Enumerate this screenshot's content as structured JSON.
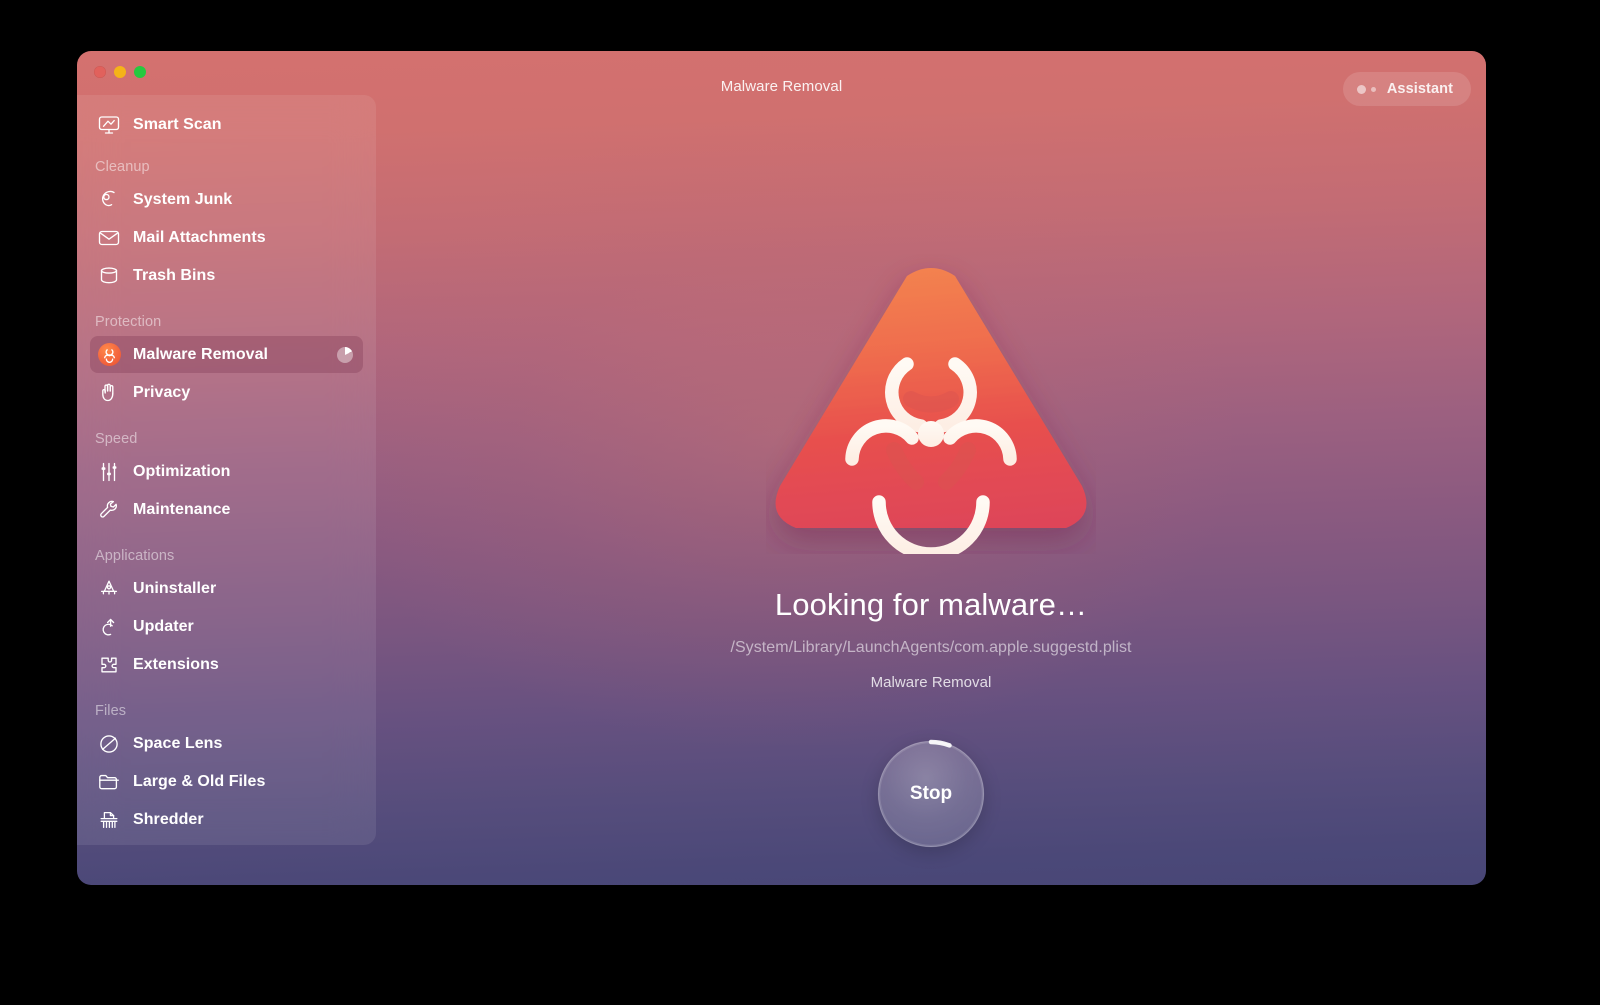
{
  "window": {
    "title": "Malware Removal",
    "traffic_lights": [
      {
        "name": "close",
        "color": "#e1615c"
      },
      {
        "name": "minimize",
        "color": "#f5b318"
      },
      {
        "name": "maximize",
        "color": "#26c93f"
      }
    ],
    "assistant_button": {
      "label": "Assistant"
    }
  },
  "sidebar": {
    "top_item": {
      "label": "Smart Scan",
      "icon": "monitor-scan-icon"
    },
    "sections": [
      {
        "title": "Cleanup",
        "items": [
          {
            "label": "System Junk",
            "icon": "broom-icon"
          },
          {
            "label": "Mail Attachments",
            "icon": "envelope-icon"
          },
          {
            "label": "Trash Bins",
            "icon": "trash-bin-icon"
          }
        ]
      },
      {
        "title": "Protection",
        "items": [
          {
            "label": "Malware Removal",
            "icon": "biohazard-icon",
            "selected": true,
            "progress_badge": true
          },
          {
            "label": "Privacy",
            "icon": "hand-palm-icon"
          }
        ]
      },
      {
        "title": "Speed",
        "items": [
          {
            "label": "Optimization",
            "icon": "sliders-icon"
          },
          {
            "label": "Maintenance",
            "icon": "wrench-icon"
          }
        ]
      },
      {
        "title": "Applications",
        "items": [
          {
            "label": "Uninstaller",
            "icon": "rocket-icon"
          },
          {
            "label": "Updater",
            "icon": "curved-arrow-up-icon"
          },
          {
            "label": "Extensions",
            "icon": "puzzle-piece-icon"
          }
        ]
      },
      {
        "title": "Files",
        "items": [
          {
            "label": "Space Lens",
            "icon": "planet-lens-icon"
          },
          {
            "label": "Large & Old Files",
            "icon": "folder-icon"
          },
          {
            "label": "Shredder",
            "icon": "shredder-icon"
          }
        ]
      }
    ]
  },
  "main": {
    "hero_icon": "biohazard-triangle-icon",
    "status_title": "Looking for malware…",
    "status_path": "/System/Library/LaunchAgents/com.apple.suggestd.plist",
    "status_module": "Malware Removal",
    "stop_button": {
      "label": "Stop"
    }
  },
  "colors": {
    "gradient_top": "#d4716f",
    "gradient_mid": "#8e5c7c",
    "gradient_bottom": "#484676",
    "accent_orange": "#f4663f",
    "accent_red": "#e24a4a"
  }
}
